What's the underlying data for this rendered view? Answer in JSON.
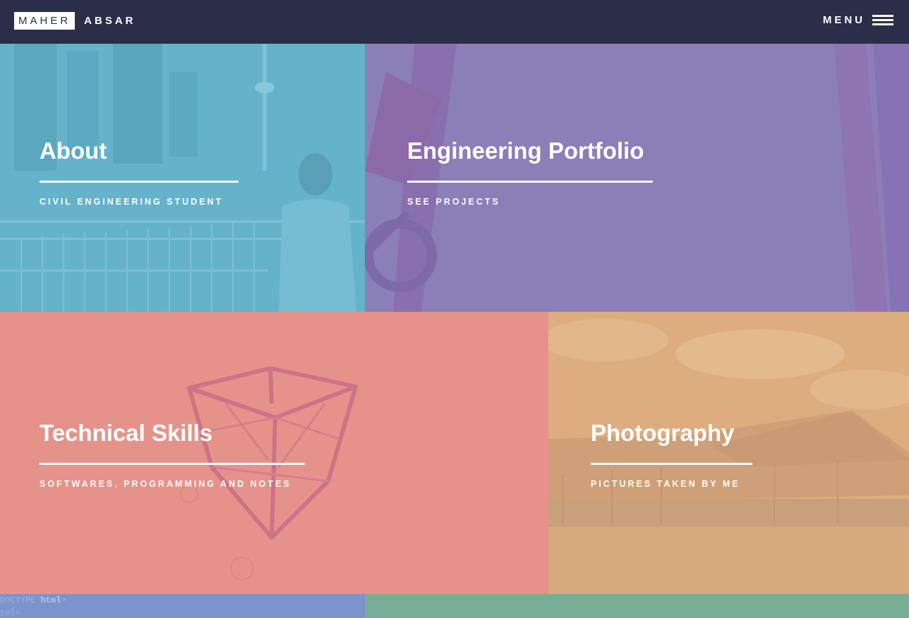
{
  "header": {
    "logo_first": "MAHER",
    "logo_last": "ABSAR",
    "menu_label": "MENU"
  },
  "tiles": [
    {
      "title": "About",
      "subtitle": "CIVIL ENGINEERING STUDENT",
      "color": "#64b3cb"
    },
    {
      "title": "Engineering Portfolio",
      "subtitle": "SEE PROJECTS",
      "color": "#8b7fb8"
    },
    {
      "title": "Technical Skills",
      "subtitle": "SOFTWARES, PROGRAMMING AND NOTES",
      "color": "#e5938a"
    },
    {
      "title": "Photography",
      "subtitle": "PICTURES TAKEN BY ME",
      "color": "#dcaa7e"
    },
    {
      "color": "#7d93cb",
      "code_line1_a": "DOCTYPE ",
      "code_line1_b": "html",
      "code_line1_c": ">",
      "code_line2": "tml>"
    },
    {
      "color": "#78ae95"
    }
  ]
}
